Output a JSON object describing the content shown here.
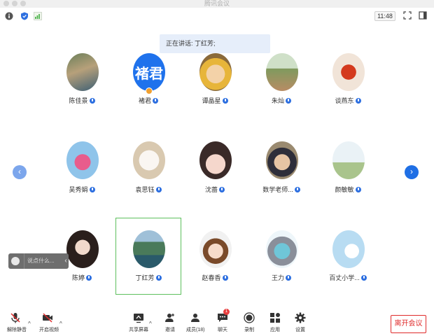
{
  "window": {
    "title": "腾讯会议"
  },
  "toolbar": {
    "clock": "11:48"
  },
  "banner": {
    "speaking_text": "正在讲话: 丁红芳;"
  },
  "colors": {
    "accent": "#1f6fe5",
    "active_border": "#5dbf5d",
    "leave": "#e02b2b"
  },
  "participants": [
    {
      "name": "陈佳景",
      "avatar": "photo"
    },
    {
      "name": "褚君",
      "avatar": "text",
      "avatar_text": "褚君",
      "host": true
    },
    {
      "name": "谭晶星",
      "avatar": "photo"
    },
    {
      "name": "朱灿",
      "avatar": "photo"
    },
    {
      "name": "谈燕东",
      "avatar": "photo"
    },
    {
      "name": "吴秀娟",
      "avatar": "photo"
    },
    {
      "name": "袁思钰",
      "avatar": "photo"
    },
    {
      "name": "沈蔷",
      "avatar": "photo"
    },
    {
      "name": "数学老师...",
      "avatar": "photo"
    },
    {
      "name": "颜敏敏",
      "avatar": "photo"
    },
    {
      "name": "陈婷",
      "avatar": "photo"
    },
    {
      "name": "丁红芳",
      "avatar": "photo",
      "active": true
    },
    {
      "name": "赵春香",
      "avatar": "photo"
    },
    {
      "name": "王力",
      "avatar": "photo"
    },
    {
      "name": "百丈小学...",
      "avatar": "photo"
    }
  ],
  "chat": {
    "placeholder": "说点什么..."
  },
  "bottom": {
    "unmute": "解除静音",
    "video": "开启视频",
    "share": "共享屏幕",
    "invite": "邀请",
    "members": "成员(18)",
    "chat": "聊天",
    "chat_badge": "1",
    "record": "录制",
    "apps": "应用",
    "settings": "设置",
    "leave": "离开会议"
  }
}
